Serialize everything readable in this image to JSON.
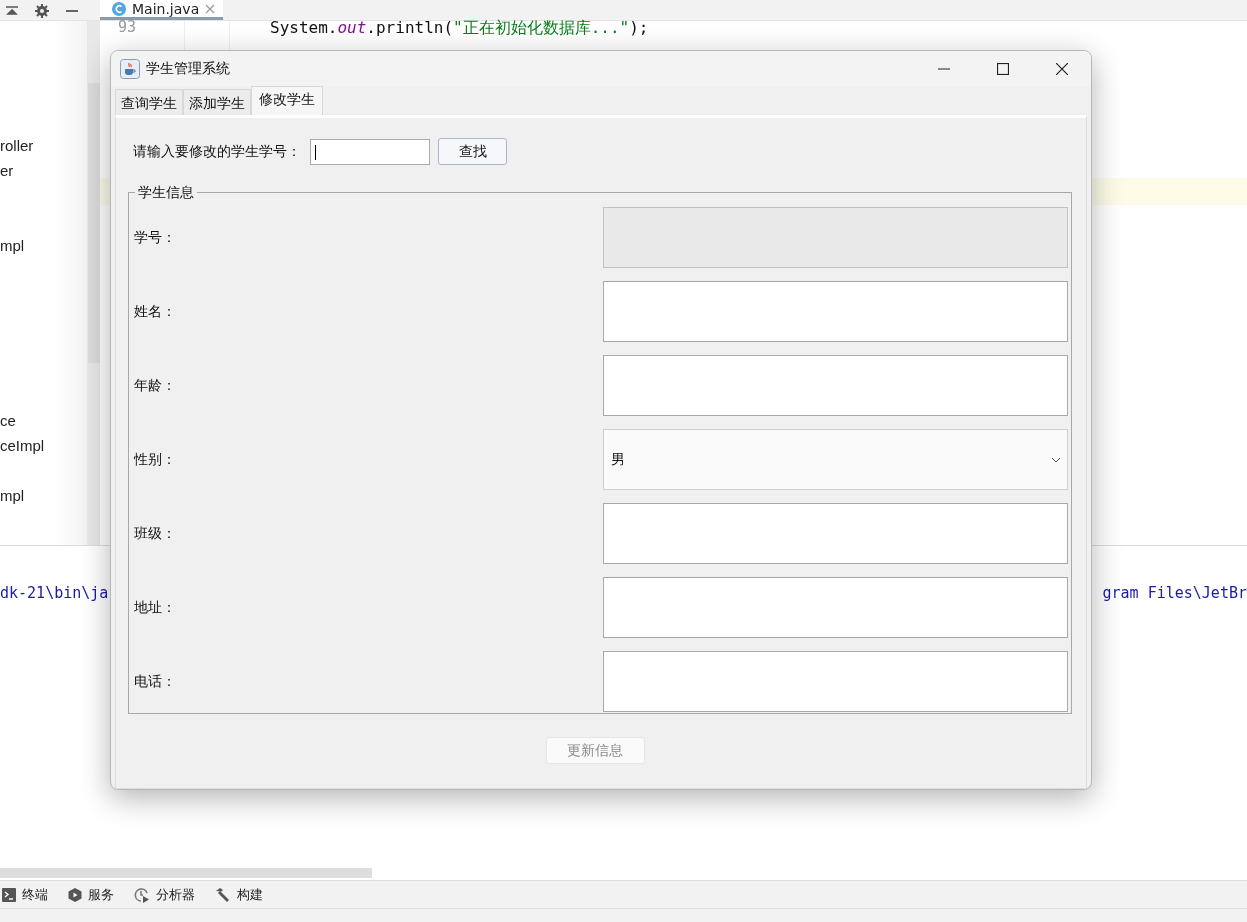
{
  "ide": {
    "editor_tab": {
      "label": "Main.java",
      "selected": true
    },
    "gutter": {
      "line_numbers": [
        "93"
      ]
    },
    "code_line": {
      "tokens": [
        {
          "kind": "plain",
          "text": "System."
        },
        {
          "kind": "field",
          "text": "out"
        },
        {
          "kind": "plain",
          "text": ".println("
        },
        {
          "kind": "string",
          "text": "\"正在初始化数据库...\""
        },
        {
          "kind": "plain",
          "text": ");"
        }
      ]
    },
    "project_tree": [
      "roller",
      "er",
      "mpl",
      "ce",
      "ceImpl",
      "mpl"
    ],
    "console": {
      "fragments": [
        "dk-21\\bin\\ja",
        "gram Files\\JetBr"
      ]
    },
    "bottom_tools": [
      {
        "kind": "terminal",
        "label": "终端"
      },
      {
        "kind": "services",
        "label": "服务"
      },
      {
        "kind": "profiler",
        "label": "分析器"
      },
      {
        "kind": "build",
        "label": "构建"
      }
    ]
  },
  "window": {
    "title": "学生管理系统",
    "tabs": [
      {
        "label": "查询学生",
        "selected": false
      },
      {
        "label": "添加学生",
        "selected": false
      },
      {
        "label": "修改学生",
        "selected": true
      }
    ],
    "search": {
      "label": "请输入要修改的学生学号：",
      "focused": true,
      "button": "查找"
    },
    "group": {
      "title": "学生信息",
      "fields": [
        {
          "label": "学号：",
          "kind": "text",
          "disabled": true
        },
        {
          "label": "姓名：",
          "kind": "text",
          "disabled": false
        },
        {
          "label": "年龄：",
          "kind": "text",
          "disabled": false
        },
        {
          "label": "性别：",
          "kind": "combo",
          "value": "男",
          "disabled": false
        },
        {
          "label": "班级：",
          "kind": "text",
          "disabled": false
        },
        {
          "label": "地址：",
          "kind": "text",
          "disabled": false
        },
        {
          "label": "电话：",
          "kind": "text",
          "disabled": false
        }
      ]
    },
    "update_button": {
      "label": "更新信息",
      "disabled": true
    }
  }
}
